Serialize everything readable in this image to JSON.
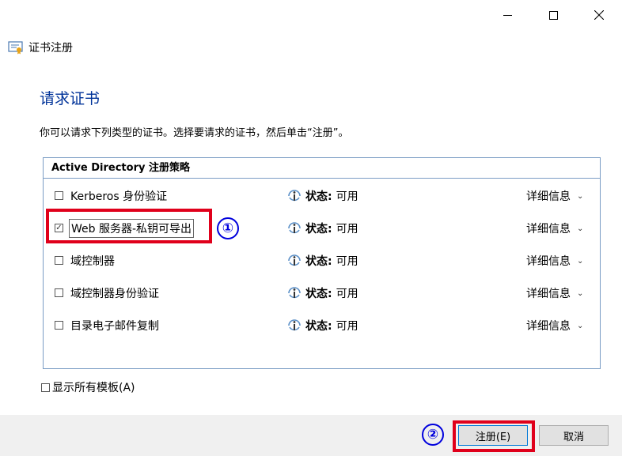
{
  "window": {
    "title": "证书注册",
    "controls": [
      "minimize-icon",
      "maximize-icon",
      "close-icon"
    ]
  },
  "page": {
    "heading": "请求证书",
    "description": "你可以请求下列类型的证书。选择要请求的证书，然后单击“注册”。"
  },
  "policy_panel": {
    "header": "Active Directory 注册策略",
    "rows": [
      {
        "label": "Kerberos 身份验证",
        "checked": false,
        "status_label": "状态:",
        "status_value": "可用",
        "details": "详细信息"
      },
      {
        "label": "Web 服务器-私钥可导出",
        "checked": true,
        "status_label": "状态:",
        "status_value": "可用",
        "details": "详细信息"
      },
      {
        "label": "域控制器",
        "checked": false,
        "status_label": "状态:",
        "status_value": "可用",
        "details": "详细信息"
      },
      {
        "label": "域控制器身份验证",
        "checked": false,
        "status_label": "状态:",
        "status_value": "可用",
        "details": "详细信息"
      },
      {
        "label": "目录电子邮件复制",
        "checked": false,
        "status_label": "状态:",
        "status_value": "可用",
        "details": "详细信息"
      }
    ]
  },
  "show_all_templates": "显示所有模板(A)",
  "annotations": {
    "marker_1": "①",
    "marker_2": "②"
  },
  "footer": {
    "enroll_label": "注册(E)",
    "cancel_label": "取消"
  },
  "colors": {
    "heading": "#003399",
    "highlight_frame": "#e0001b",
    "marker": "#0000dd",
    "panel_border": "#7a9cc4"
  }
}
